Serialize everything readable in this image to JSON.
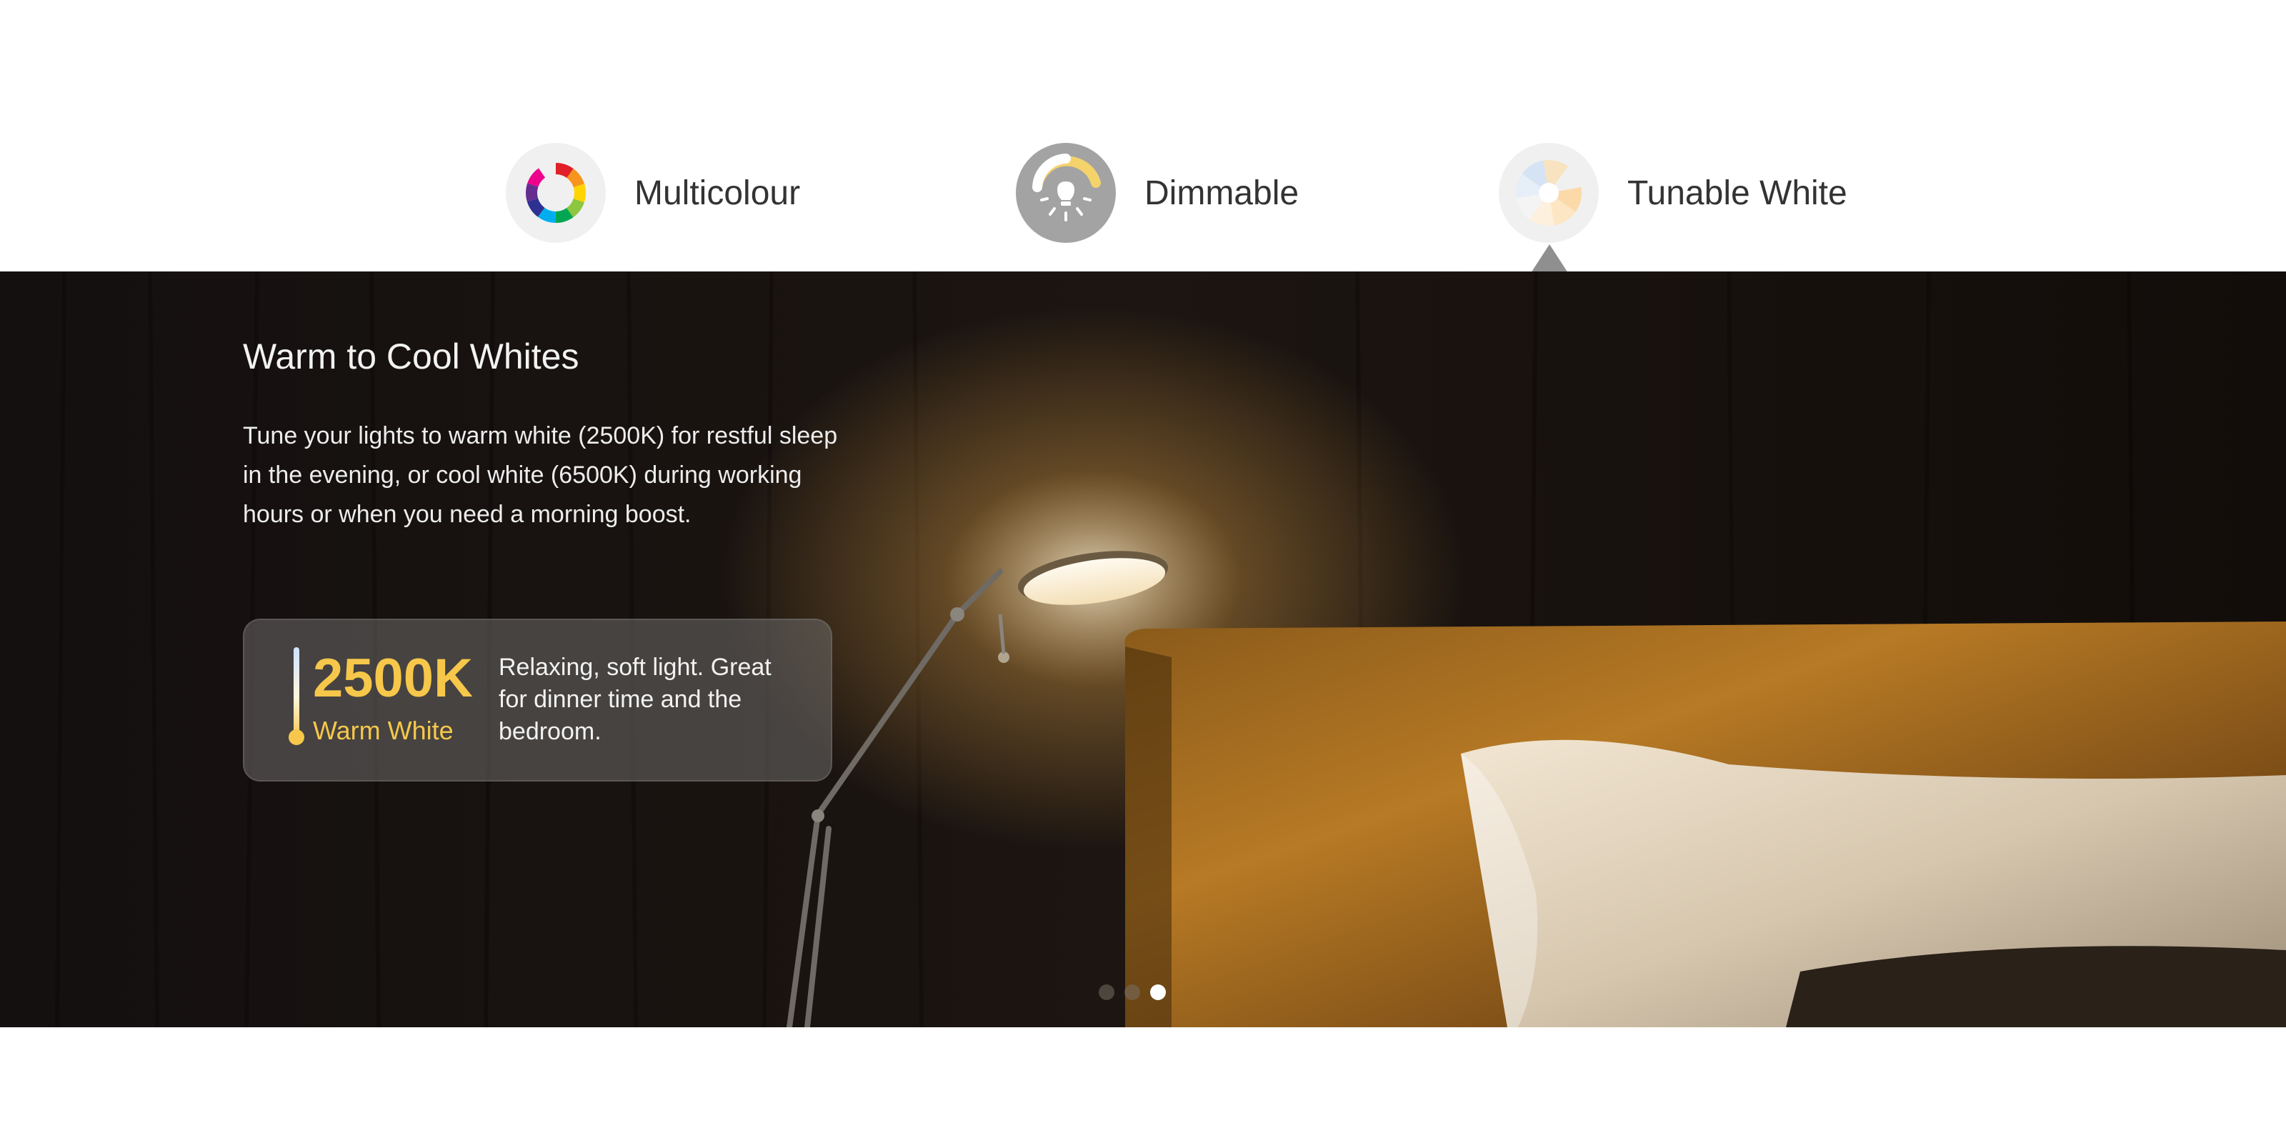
{
  "tabs": [
    {
      "label": "Multicolour",
      "icon": "color-wheel-icon",
      "active": false
    },
    {
      "label": "Dimmable",
      "icon": "dimmable-bulb-icon",
      "active": false
    },
    {
      "label": "Tunable White",
      "icon": "tunable-white-wheel-icon",
      "active": true
    }
  ],
  "hero": {
    "title": "Warm to Cool Whites",
    "description": "Tune your lights to warm white (2500K) for restful sleep in the evening, or cool white (6500K) during working hours or when you need a morning boost.",
    "card": {
      "temperature": "2500K",
      "name": "Warm White",
      "description": "Relaxing, soft light. Great for dinner time and the bedroom.",
      "icon": "thermometer-icon"
    }
  },
  "carousel": {
    "slide_count": 3,
    "active_index": 2
  },
  "colors": {
    "accent_warm": "#f6c74a",
    "tab_text": "#333333",
    "pointer": "#8f8f8f"
  }
}
